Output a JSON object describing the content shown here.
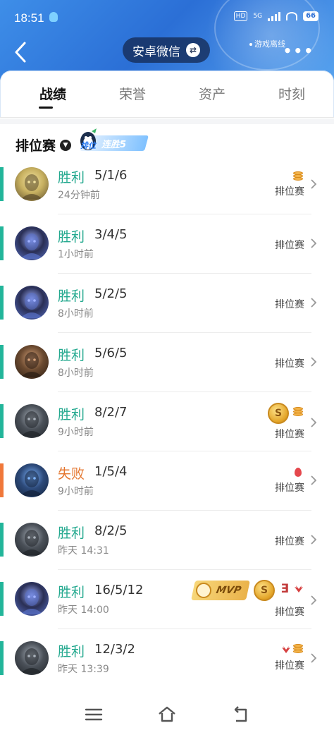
{
  "status_bar": {
    "time": "18:51",
    "hd": "HD",
    "net": "5G",
    "battery": "66"
  },
  "header": {
    "account": "安卓微信",
    "offline": "游戏离线",
    "more": "•••"
  },
  "tabs": [
    {
      "label": "战绩",
      "active": true
    },
    {
      "label": "荣誉",
      "active": false
    },
    {
      "label": "资产",
      "active": false
    },
    {
      "label": "时刻",
      "active": false
    }
  ],
  "mode": {
    "title": "排位赛",
    "badge_small": "排位",
    "badge_streak": "连胜5"
  },
  "colors": {
    "win": "#22a88e",
    "loss": "#e4762f",
    "header_blue": "#2b6fd6"
  },
  "matches": [
    {
      "result": "胜利",
      "kda": "5/1/6",
      "time": "24分钟前",
      "type": "排位赛",
      "win": true,
      "icons": [
        "coin-icon"
      ]
    },
    {
      "result": "胜利",
      "kda": "3/4/5",
      "time": "1小时前",
      "type": "排位赛",
      "win": true,
      "icons": []
    },
    {
      "result": "胜利",
      "kda": "5/2/5",
      "time": "8小时前",
      "type": "排位赛",
      "win": true,
      "icons": []
    },
    {
      "result": "胜利",
      "kda": "5/6/5",
      "time": "8小时前",
      "type": "排位赛",
      "win": true,
      "icons": []
    },
    {
      "result": "胜利",
      "kda": "8/2/7",
      "time": "9小时前",
      "type": "排位赛",
      "win": true,
      "icons": [
        "gold-medal-icon",
        "coin-icon"
      ]
    },
    {
      "result": "失败",
      "kda": "1/5/4",
      "time": "9小时前",
      "type": "排位赛",
      "win": false,
      "icons": [
        "blood-drop-icon"
      ]
    },
    {
      "result": "胜利",
      "kda": "8/2/5",
      "time": "昨天 14:31",
      "type": "排位赛",
      "win": true,
      "icons": []
    },
    {
      "result": "胜利",
      "kda": "16/5/12",
      "time": "昨天 14:00",
      "type": "排位赛",
      "win": true,
      "icons": [
        "mvp-badge-icon",
        "gold-medal-icon",
        "triple-kill-icon",
        "wings-icon"
      ],
      "mvp_label": "MVP",
      "kill_tag": "Ǝ"
    },
    {
      "result": "胜利",
      "kda": "12/3/2",
      "time": "昨天 13:39",
      "type": "排位赛",
      "win": true,
      "icons": [
        "wings-icon",
        "coin-icon"
      ]
    }
  ],
  "bottom_nav": [
    "menu-icon",
    "home-icon",
    "back-icon"
  ]
}
